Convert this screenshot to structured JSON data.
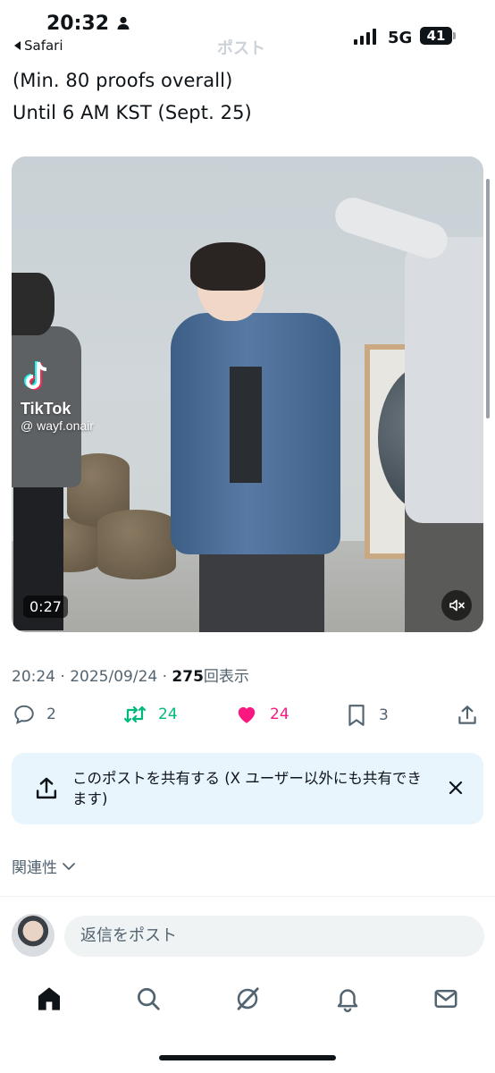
{
  "status_bar": {
    "time": "20:32",
    "back_app": "Safari",
    "network": "5G",
    "battery": "41"
  },
  "header": {
    "title": "ポスト"
  },
  "tweet": {
    "lines": [
      "(Min. 80 proofs overall)",
      "Until 6 AM KST (Sept. 25)"
    ]
  },
  "video": {
    "watermark_brand": "TikTok",
    "watermark_handle": "@ wayf.onair",
    "duration": "0:27"
  },
  "meta": {
    "time": "20:24",
    "date": "2025/09/24",
    "views_count": "275",
    "views_label": "回表示",
    "separator": "·"
  },
  "actions": {
    "replies": "2",
    "reposts": "24",
    "likes": "24",
    "bookmarks": "3",
    "repost_color": "#00ba7c",
    "like_color": "#f91880"
  },
  "share_banner": {
    "text": "このポストを共有する (X ユーザー以外にも共有できます)"
  },
  "sort": {
    "label": "関連性"
  },
  "composer": {
    "placeholder": "返信をポスト"
  },
  "bottom_nav": {
    "items": [
      "home-icon",
      "search-icon",
      "grok-icon",
      "notifications-icon",
      "messages-icon"
    ]
  }
}
